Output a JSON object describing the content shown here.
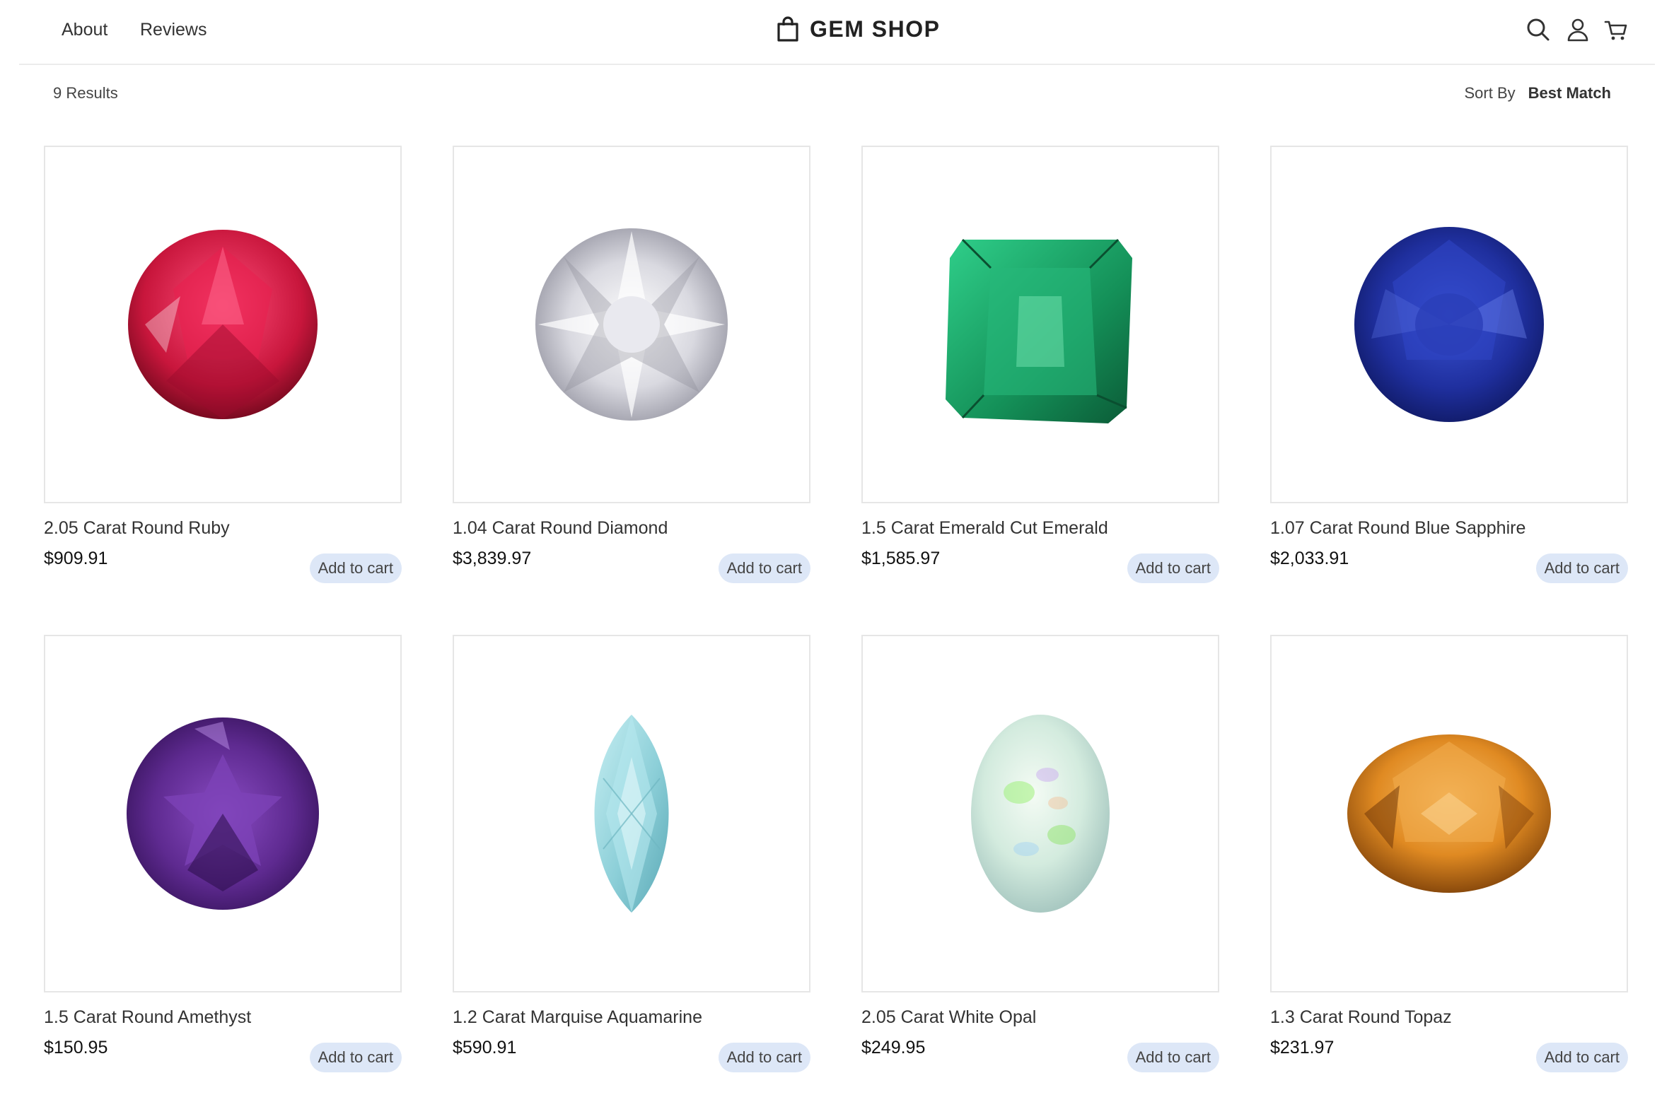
{
  "header": {
    "nav": [
      {
        "label": "About"
      },
      {
        "label": "Reviews"
      }
    ],
    "brand": "GEM SHOP",
    "icons": [
      "shopping-bag-icon",
      "search-icon",
      "user-icon",
      "cart-icon"
    ]
  },
  "results": {
    "count_label": "9 Results",
    "sort_label": "Sort By",
    "sort_value": "Best Match"
  },
  "products": [
    {
      "title": "2.05 Carat Round Ruby",
      "price": "$909.91",
      "button": "Add to cart",
      "gem": "ruby",
      "color": "#d01a44"
    },
    {
      "title": "1.04 Carat Round Diamond",
      "price": "$3,839.97",
      "button": "Add to cart",
      "gem": "diamond",
      "color": "#d8d8de"
    },
    {
      "title": "1.5 Carat Emerald Cut Emerald",
      "price": "$1,585.97",
      "button": "Add to cart",
      "gem": "emerald",
      "color": "#1c9a5e"
    },
    {
      "title": "1.07 Carat Round Blue Sapphire",
      "price": "$2,033.91",
      "button": "Add to cart",
      "gem": "sapphire",
      "color": "#2437a6"
    },
    {
      "title": "1.5 Carat Round Amethyst",
      "price": "$150.95",
      "button": "Add to cart",
      "gem": "amethyst",
      "color": "#6a2f9a"
    },
    {
      "title": "1.2 Carat Marquise Aquamarine",
      "price": "$590.91",
      "button": "Add to cart",
      "gem": "aquamarine",
      "color": "#8fd1da"
    },
    {
      "title": "2.05 Carat White Opal",
      "price": "$249.95",
      "button": "Add to cart",
      "gem": "opal",
      "color": "#d7eede"
    },
    {
      "title": "1.3 Carat Round Topaz",
      "price": "$231.97",
      "button": "Add to cart",
      "gem": "topaz",
      "color": "#e8902a"
    }
  ]
}
